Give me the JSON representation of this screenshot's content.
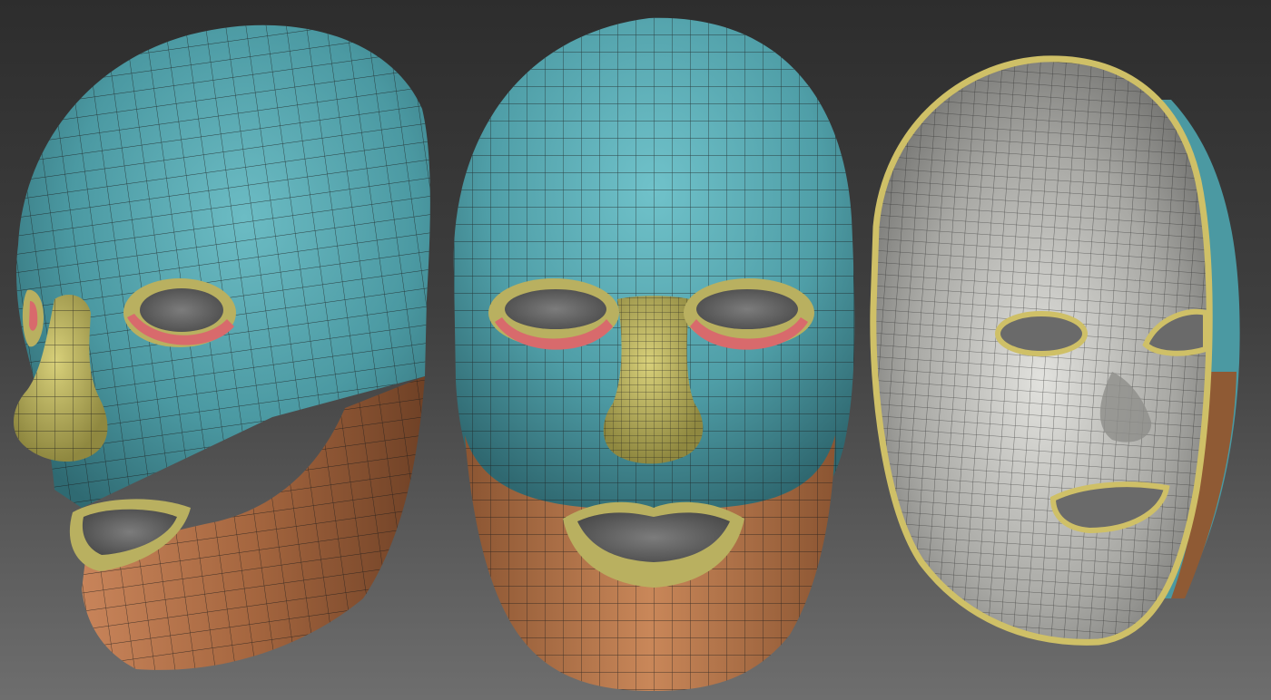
{
  "scene": {
    "background_top": "#2d2d2d",
    "background_bottom": "#6e6e6e",
    "views": [
      {
        "name": "three-quarter-left",
        "kind": "exterior"
      },
      {
        "name": "front",
        "kind": "exterior"
      },
      {
        "name": "back-interior",
        "kind": "interior"
      }
    ]
  },
  "polygroups": {
    "forehead": "#52a4ad",
    "jaw": "#b06f45",
    "nose_and_lips": "#b9b060",
    "lower_eyelid": "#d86a6c",
    "interior": "#b9b9b5",
    "rim": "#cfc067",
    "wire": "#1a1a1a"
  }
}
